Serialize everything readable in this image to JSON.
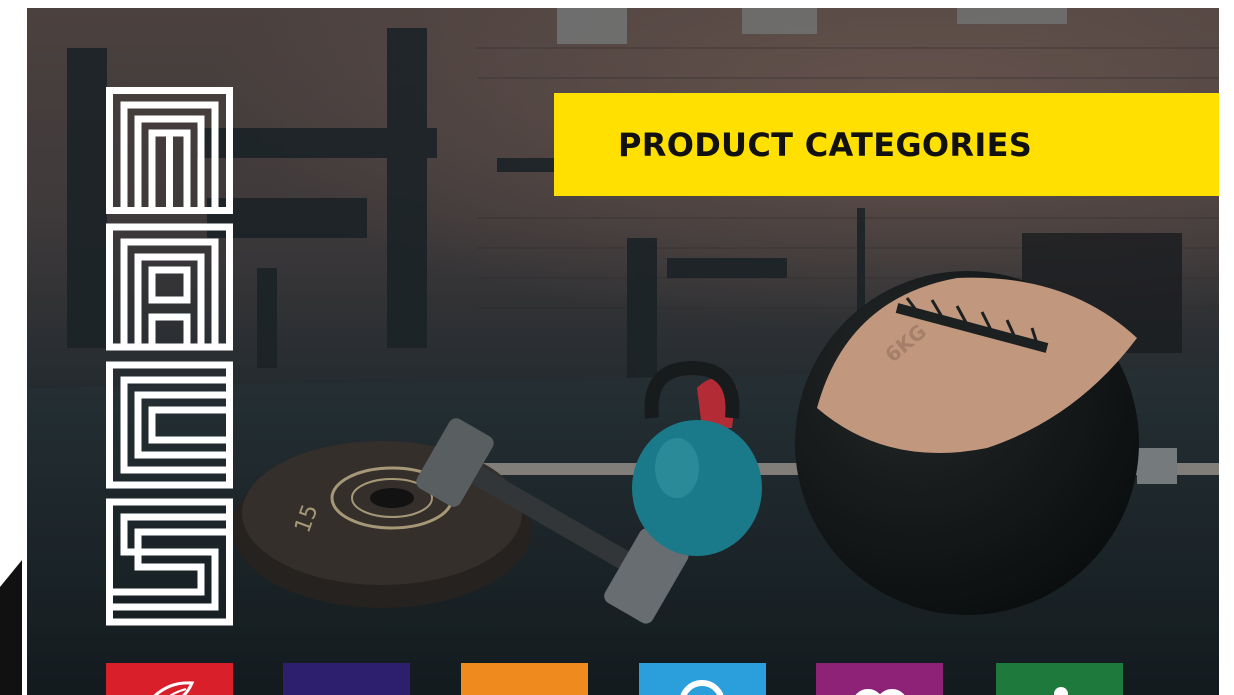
{
  "banner": {
    "title": "PRODUCT CATEGORIES"
  },
  "colors": {
    "banner_yellow": "#ffe000",
    "logo_white": "#ffffff"
  },
  "hero_image": {
    "ball_label": "6KG",
    "plate_label": "15"
  },
  "category_tiles": [
    {
      "icon": "leaf-icon",
      "color": "#d81f2a"
    },
    {
      "icon": "blank-tile",
      "color": "#2d1f6e"
    },
    {
      "icon": "blank-tile",
      "color": "#ef8a1e"
    },
    {
      "icon": "ring-icon",
      "color": "#2b9fdb"
    },
    {
      "icon": "infinity-icon",
      "color": "#8e2277"
    },
    {
      "icon": "person-icon",
      "color": "#1e7a3c"
    }
  ]
}
